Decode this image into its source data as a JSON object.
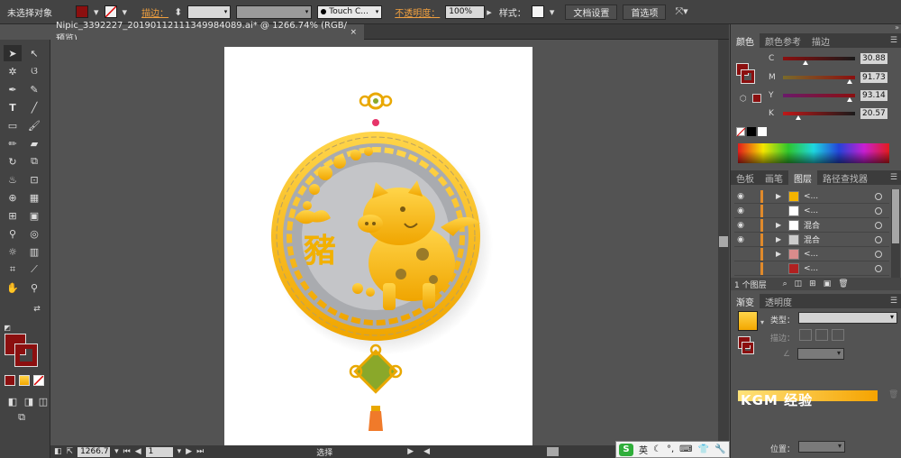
{
  "control_bar": {
    "selection_status": "未选择对象",
    "stroke_label": "描边：",
    "brush_name": "Touch C...",
    "opacity_label": "不透明度：",
    "opacity_value": "100%",
    "style_label": "样式：",
    "doc_settings_button": "文档设置",
    "preferences_button": "首选项"
  },
  "document": {
    "tab_title": "Nipic_3392227_20190112111349984089.ai* @ 1266.74% (RGB/预览)",
    "close_glyph": "×"
  },
  "status_bar": {
    "zoom": "1266.7",
    "artboard": "1",
    "tool_name": "选择"
  },
  "color_panel": {
    "tabs": [
      "颜色",
      "颜色参考",
      "描边"
    ],
    "channels": [
      {
        "key": "C",
        "value": "30.88",
        "fraction": 0.31
      },
      {
        "key": "M",
        "value": "91.73",
        "fraction": 0.92
      },
      {
        "key": "Y",
        "value": "93.14",
        "fraction": 0.93
      },
      {
        "key": "K",
        "value": "20.57",
        "fraction": 0.21
      }
    ],
    "fill_color": "#8b0f0f"
  },
  "layers_panel": {
    "tabs": [
      "色板",
      "画笔",
      "图层",
      "路径查找器"
    ],
    "rows": [
      {
        "name": "<...",
        "visible": true,
        "expand": true
      },
      {
        "name": "<...",
        "visible": true,
        "expand": false
      },
      {
        "name": "混合",
        "visible": true,
        "expand": true
      },
      {
        "name": "混合",
        "visible": true,
        "expand": true
      },
      {
        "name": "<...",
        "visible": false,
        "expand": true
      },
      {
        "name": "<...",
        "visible": false,
        "expand": false
      }
    ],
    "footer": "1 个图层"
  },
  "gradient_panel": {
    "tabs": [
      "渐变",
      "透明度"
    ],
    "type_label": "类型：",
    "stroke_label": "描边：",
    "position_label": "位置："
  },
  "artwork": {
    "character": "豬",
    "gold": "#f5b400",
    "gold_light": "#ffd54a",
    "red": "#8b0f0f"
  },
  "ime": {
    "lang": "英",
    "logo": "S"
  },
  "watermark": "KGM 经验"
}
